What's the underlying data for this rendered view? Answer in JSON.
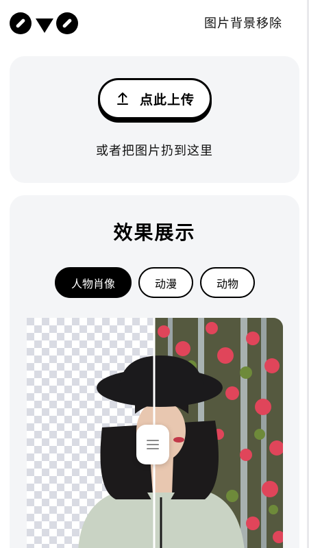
{
  "header": {
    "logo_name": "logo",
    "nav_title": "图片背景移除"
  },
  "upload": {
    "button_label": "点此上传",
    "button_icon": "upload-icon",
    "drop_hint": "或者把图片扔到这里"
  },
  "results": {
    "title": "效果展示",
    "tabs": [
      {
        "label": "人物肖像",
        "active": true
      },
      {
        "label": "动漫",
        "active": false
      },
      {
        "label": "动物",
        "active": false
      }
    ],
    "comparison": {
      "left_side": "transparent-checkerboard",
      "right_side": "original-photo",
      "handle_icon": "drag-handle-icon"
    }
  },
  "colors": {
    "card_bg": "#f4f5f7",
    "accent": "#000000",
    "flower": "#e0455a"
  }
}
